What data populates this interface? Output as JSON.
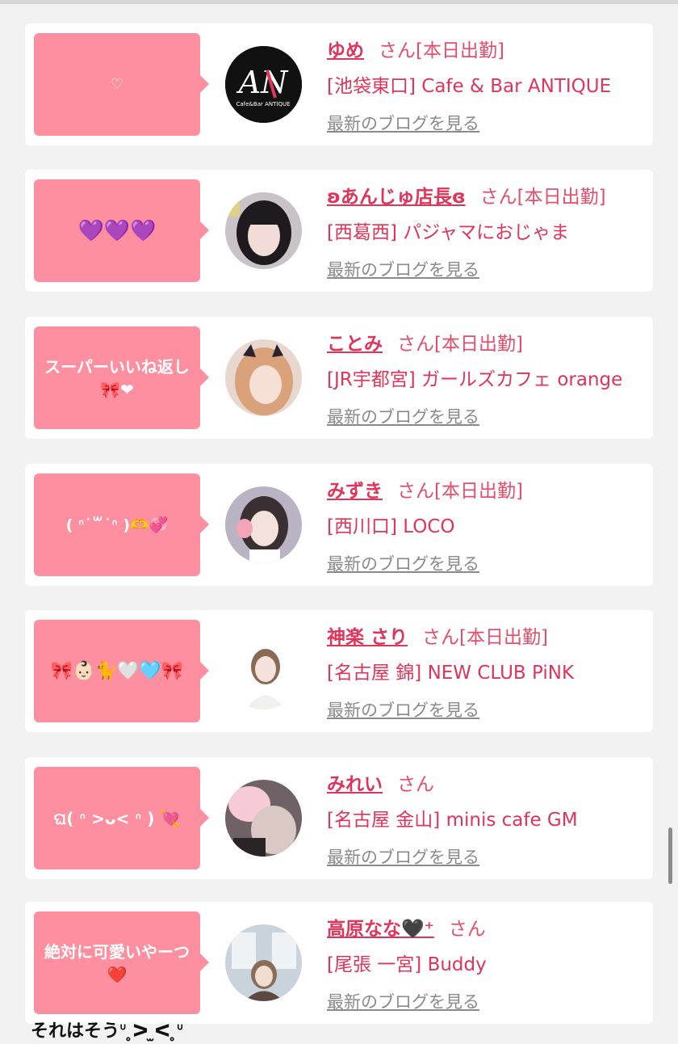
{
  "cards": [
    {
      "message": "♡",
      "name": "ゆめ",
      "san": "さん",
      "status": "[本日出勤]",
      "shop": "[池袋東口] Cafe & Bar ANTIQUE",
      "blog_link": "最新のブログを見る",
      "avatar_text": "AN",
      "avatar_sub": "Cafe&Bar ANTIQUE"
    },
    {
      "message": "💜💜💜",
      "name": "ʚあんじゅ店長ɞ",
      "san": "さん",
      "status": "[本日出勤]",
      "shop": "[西葛西] パジャマにおじゃま",
      "blog_link": "最新のブログを見る"
    },
    {
      "message": "スーパーいいね返し🎀❤︎",
      "name": "ことみ",
      "san": "さん",
      "status": "[本日出勤]",
      "shop": "[JR宇都宮] ガールズカフェ orange",
      "blog_link": "最新のブログを見る"
    },
    {
      "message": "( ᐢ˙꒳˙ᐢ )🫶💞",
      "name": "みずき",
      "san": "さん",
      "status": "[本日出勤]",
      "shop": "[西川口] LOCO",
      "blog_link": "最新のブログを見る"
    },
    {
      "message": "🎀👶🏻🐈🤍🩵🎀",
      "name": "神楽 さり",
      "san": "さん",
      "status": "[本日出勤]",
      "shop": "[名古屋 錦] NEW CLUB PiNK",
      "blog_link": "最新のブログを見る"
    },
    {
      "message": "ଘ( ᐢ >ᴗ< ᐢ ) 💘",
      "name": "みれい",
      "san": "さん",
      "status": "",
      "shop": "[名古屋 金山] minis cafe GM",
      "blog_link": "最新のブログを見る"
    },
    {
      "message": "絶対に可愛いやーつ❤️",
      "name": "高原なな🖤⁺",
      "san": "さん",
      "status": "",
      "shop": "[尾張 一宮] Buddy",
      "blog_link": "最新のブログを見る"
    }
  ],
  "footer_caption": "それはそうᐡ ̥ᐳ ̫ᐸ ̥ᐡ",
  "colors": {
    "bubble": "#fd8fa0",
    "name": "#e0345a",
    "link": "#8a8a8a",
    "background": "#f2f2f2"
  }
}
